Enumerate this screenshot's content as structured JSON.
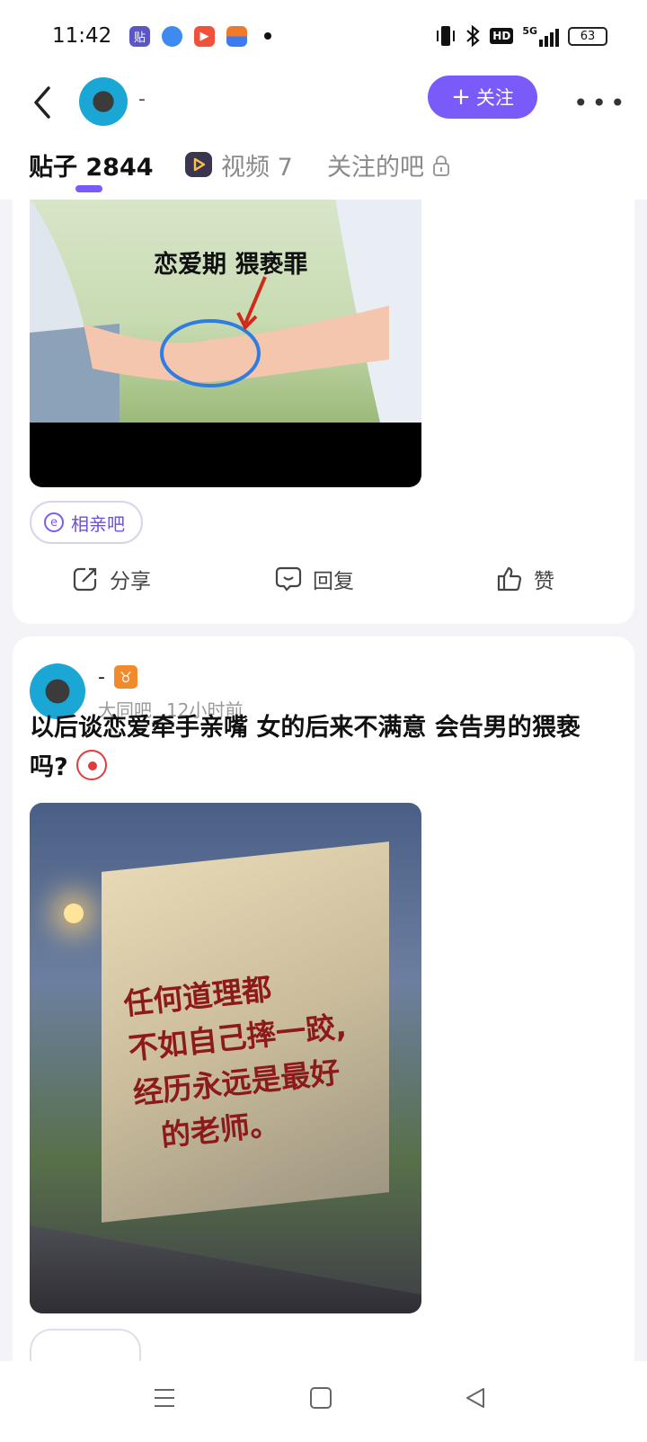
{
  "status_bar": {
    "time": "11:42",
    "notif_icons": [
      "tieba-app-icon",
      "browser-app-icon",
      "video-app-icon",
      "wallet-app-icon",
      "more-dot-icon"
    ],
    "network": "5G",
    "hd": "HD",
    "battery": "63"
  },
  "header": {
    "username": "-",
    "follow_label": "关注",
    "tabs": [
      {
        "label": "贴子 2844",
        "active": true
      },
      {
        "label": "视频 7",
        "active": false
      },
      {
        "label": "关注的吧",
        "active": false
      }
    ]
  },
  "post1": {
    "image_caption": "恋爱期 猥亵罪",
    "tag": "相亲吧",
    "actions": {
      "share": "分享",
      "reply": "回复",
      "like": "赞"
    }
  },
  "post2": {
    "author": "-",
    "forum": "大同吧",
    "time": "12小时前",
    "title": "以后谈恋爱牵手亲嘴 女的后来不满意 会告男的猥亵吗?",
    "image_text": [
      "任何道理都",
      "不如自己摔一跤,",
      "经历永远是最好",
      "的老师。"
    ]
  },
  "colors": {
    "accent": "#7a5af8",
    "background": "#f4f3f8"
  }
}
